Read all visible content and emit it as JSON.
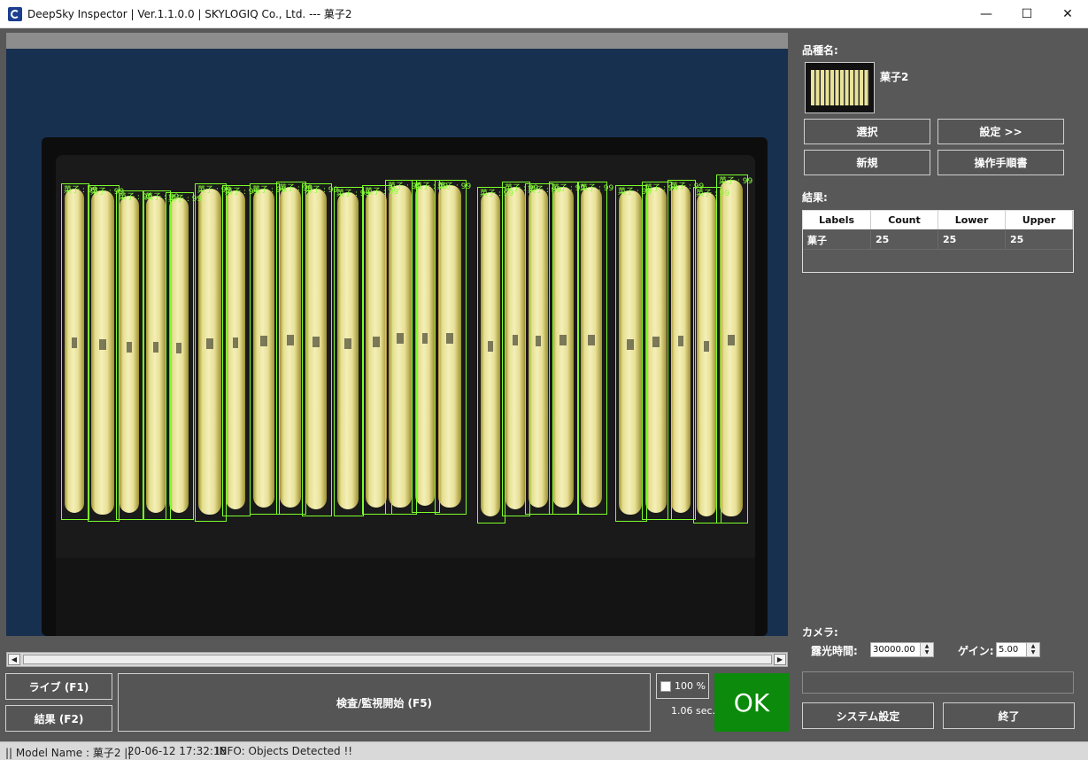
{
  "window": {
    "title": "DeepSky Inspector | Ver.1.1.0.0 | SKYLOGIQ Co., Ltd. --- 菓子2",
    "minimize": "—",
    "maximize": "☐",
    "close": "✕"
  },
  "right_panel": {
    "product_label": "品種名:",
    "product_name": "菓子2",
    "select_button": "選択",
    "settings_button": "設定 >>",
    "new_button": "新規",
    "manual_button": "操作手順書",
    "result_label": "結果:",
    "table": {
      "headers": [
        "Labels",
        "Count",
        "Lower",
        "Upper"
      ],
      "rows": [
        [
          "菓子",
          "25",
          "25",
          "25"
        ]
      ]
    },
    "camera_label": "カメラ:",
    "exposure_label": "露光時間:",
    "exposure_value": "30000.00",
    "gain_label": "ゲイン:",
    "gain_value": "5.00",
    "system_settings_button": "システム設定",
    "exit_button": "終了"
  },
  "bottom": {
    "live_button": "ライブ (F1)",
    "result_button": "結果 (F2)",
    "inspect_button": "検査/監視開始 (F5)",
    "zoom_label": "100 %",
    "time_label": "1.06 sec.",
    "ok_label": "OK"
  },
  "status": {
    "model": "|| Model Name : 菓子2 ||",
    "timestamp": "20-06-12 17:32:18",
    "info": "INFO:   Objects Detected !!"
  },
  "detections": [
    {
      "label": "菓子 : 99"
    },
    {
      "label": "菓子 : 99"
    },
    {
      "label": "菓子 : 99"
    },
    {
      "label": "菓子 : 99"
    },
    {
      "label": "菓子 : 99"
    },
    {
      "label": "菓子 : 99"
    },
    {
      "label": "菓子 : 99"
    },
    {
      "label": "菓子 : 99"
    },
    {
      "label": "菓子 : 99"
    },
    {
      "label": "菓子 : 99"
    },
    {
      "label": "菓子 : 99"
    },
    {
      "label": "菓子 : 99"
    },
    {
      "label": "菓子 : 99"
    },
    {
      "label": "菓子 : 99"
    },
    {
      "label": "菓子 : 99"
    },
    {
      "label": "菓子 : 99"
    },
    {
      "label": "菓子 : 99"
    },
    {
      "label": "菓子 : 99"
    },
    {
      "label": "菓子 : 99"
    },
    {
      "label": "菓子 : 99"
    },
    {
      "label": "菓子 : 99"
    },
    {
      "label": "菓子 : 99"
    },
    {
      "label": "菓子 : 99"
    },
    {
      "label": "菓子 : 99"
    },
    {
      "label": "菓子 : 99"
    }
  ],
  "colors": {
    "ok_green": "#0b8a0b",
    "detection_box": "#7cff2a",
    "panel_bg": "#585858"
  }
}
